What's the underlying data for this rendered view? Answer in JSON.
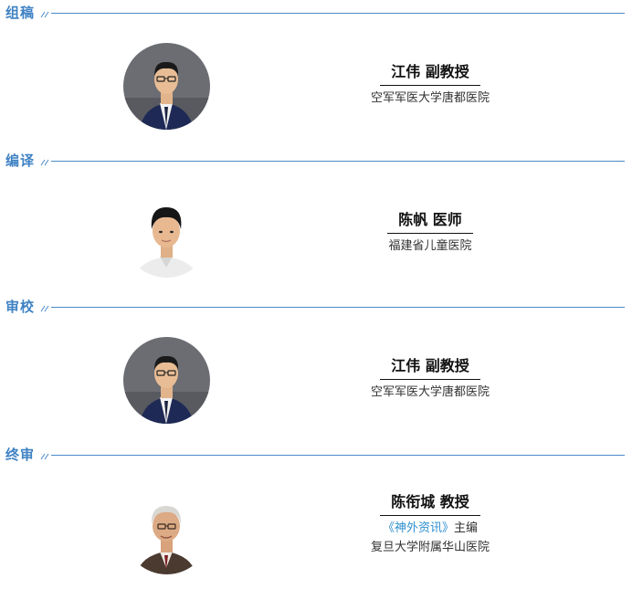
{
  "colors": {
    "accent": "#3f82c4",
    "rule": "#4a8ac9",
    "highlight": "#2f8fce"
  },
  "sections": [
    {
      "title": "组稿",
      "person": {
        "name": "江伟 副教授",
        "affiliation": "空军军医大学唐都医院",
        "avatar_icon": "male-portrait-suit-glasses"
      }
    },
    {
      "title": "编译",
      "person": {
        "name": "陈帆 医师",
        "affiliation": "福建省儿童医院",
        "avatar_icon": "male-portrait-young"
      }
    },
    {
      "title": "审校",
      "person": {
        "name": "江伟 副教授",
        "affiliation": "空军军医大学唐都医院",
        "avatar_icon": "male-portrait-suit-glasses"
      }
    },
    {
      "title": "终审",
      "person": {
        "name": "陈衔城 教授",
        "role_highlight": "《神外资讯》",
        "role_suffix": "主编",
        "affiliation": "复旦大学附属华山医院",
        "avatar_icon": "male-portrait-senior-glasses"
      }
    }
  ]
}
